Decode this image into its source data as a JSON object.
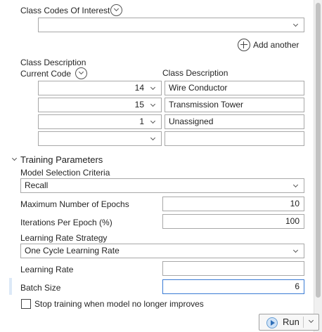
{
  "class_codes": {
    "label": "Class Codes Of Interest",
    "value": ""
  },
  "add_another_label": "Add another",
  "class_description": {
    "label": "Class Description",
    "current_code_label": "Current Code",
    "description_col_label": "Class Description",
    "rows": [
      {
        "code": "14",
        "description": "Wire Conductor"
      },
      {
        "code": "15",
        "description": "Transmission Tower"
      },
      {
        "code": "1",
        "description": "Unassigned"
      },
      {
        "code": "",
        "description": ""
      }
    ]
  },
  "training": {
    "title": "Training Parameters",
    "model_selection_label": "Model Selection Criteria",
    "model_selection_value": "Recall",
    "max_epochs_label": "Maximum Number of Epochs",
    "max_epochs_value": "10",
    "iterations_label": "Iterations Per Epoch (%)",
    "iterations_value": "100",
    "lr_strategy_label": "Learning Rate Strategy",
    "lr_strategy_value": "One Cycle Learning Rate",
    "learning_rate_label": "Learning Rate",
    "learning_rate_value": "",
    "batch_size_label": "Batch Size",
    "batch_size_value": "6",
    "stop_training_label": "Stop training when model no longer improves",
    "stop_training_checked": false
  },
  "run_label": "Run"
}
